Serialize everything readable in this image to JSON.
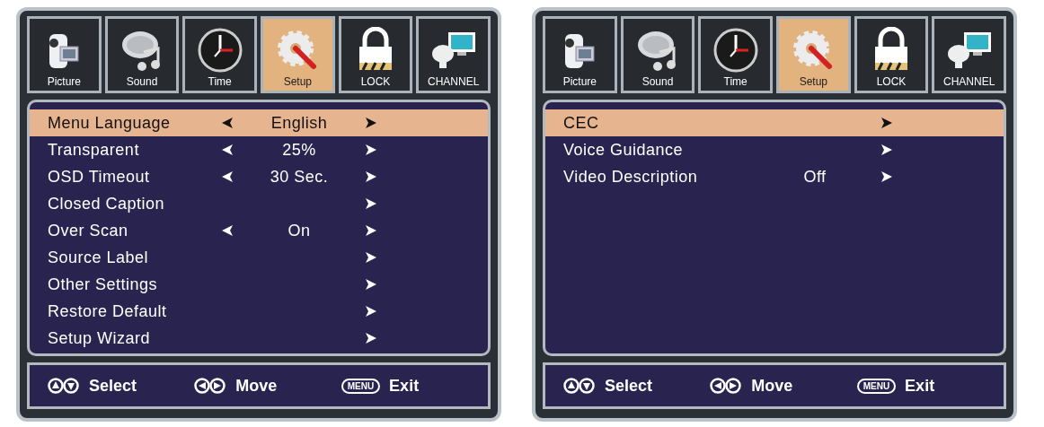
{
  "panels": [
    {
      "tabs": [
        {
          "label": "Picture",
          "kind": "camera",
          "selected": false
        },
        {
          "label": "Sound",
          "kind": "speaker",
          "selected": false
        },
        {
          "label": "Time",
          "kind": "clock",
          "selected": false
        },
        {
          "label": "Setup",
          "kind": "gear",
          "selected": true
        },
        {
          "label": "LOCK",
          "kind": "lock",
          "selected": false
        },
        {
          "label": "CHANNEL",
          "kind": "satellite",
          "selected": false
        }
      ],
      "items": [
        {
          "label": "Menu Language",
          "kind": "option",
          "value": "English",
          "selected": true
        },
        {
          "label": "Transparent",
          "kind": "option",
          "value": "25%",
          "selected": false
        },
        {
          "label": "OSD Timeout",
          "kind": "option",
          "value": "30 Sec.",
          "selected": false
        },
        {
          "label": "Closed Caption",
          "kind": "submenu",
          "selected": false
        },
        {
          "label": "Over Scan",
          "kind": "option",
          "value": "On",
          "selected": false
        },
        {
          "label": "Source Label",
          "kind": "submenu",
          "selected": false
        },
        {
          "label": "Other Settings",
          "kind": "submenu",
          "selected": false
        },
        {
          "label": "Restore Default",
          "kind": "submenu",
          "selected": false
        },
        {
          "label": "Setup Wizard",
          "kind": "submenu",
          "selected": false
        }
      ],
      "hints": [
        {
          "kind": "updown",
          "label": "Select"
        },
        {
          "kind": "leftright",
          "label": "Move"
        },
        {
          "kind": "key",
          "key": "MENU",
          "label": "Exit"
        }
      ]
    },
    {
      "tabs": [
        {
          "label": "Picture",
          "kind": "camera",
          "selected": false
        },
        {
          "label": "Sound",
          "kind": "speaker",
          "selected": false
        },
        {
          "label": "Time",
          "kind": "clock",
          "selected": false
        },
        {
          "label": "Setup",
          "kind": "gear",
          "selected": true
        },
        {
          "label": "LOCK",
          "kind": "lock",
          "selected": false
        },
        {
          "label": "CHANNEL",
          "kind": "satellite",
          "selected": false
        }
      ],
      "items": [
        {
          "label": "CEC",
          "kind": "submenu",
          "selected": true
        },
        {
          "label": "Voice Guidance",
          "kind": "submenu",
          "selected": false
        },
        {
          "label": "Video Description",
          "kind": "value",
          "value": "Off",
          "selected": false
        }
      ],
      "hints": [
        {
          "kind": "updown",
          "label": "Select"
        },
        {
          "kind": "leftright",
          "label": "Move"
        },
        {
          "kind": "key",
          "key": "MENU",
          "label": "Exit"
        }
      ]
    }
  ]
}
